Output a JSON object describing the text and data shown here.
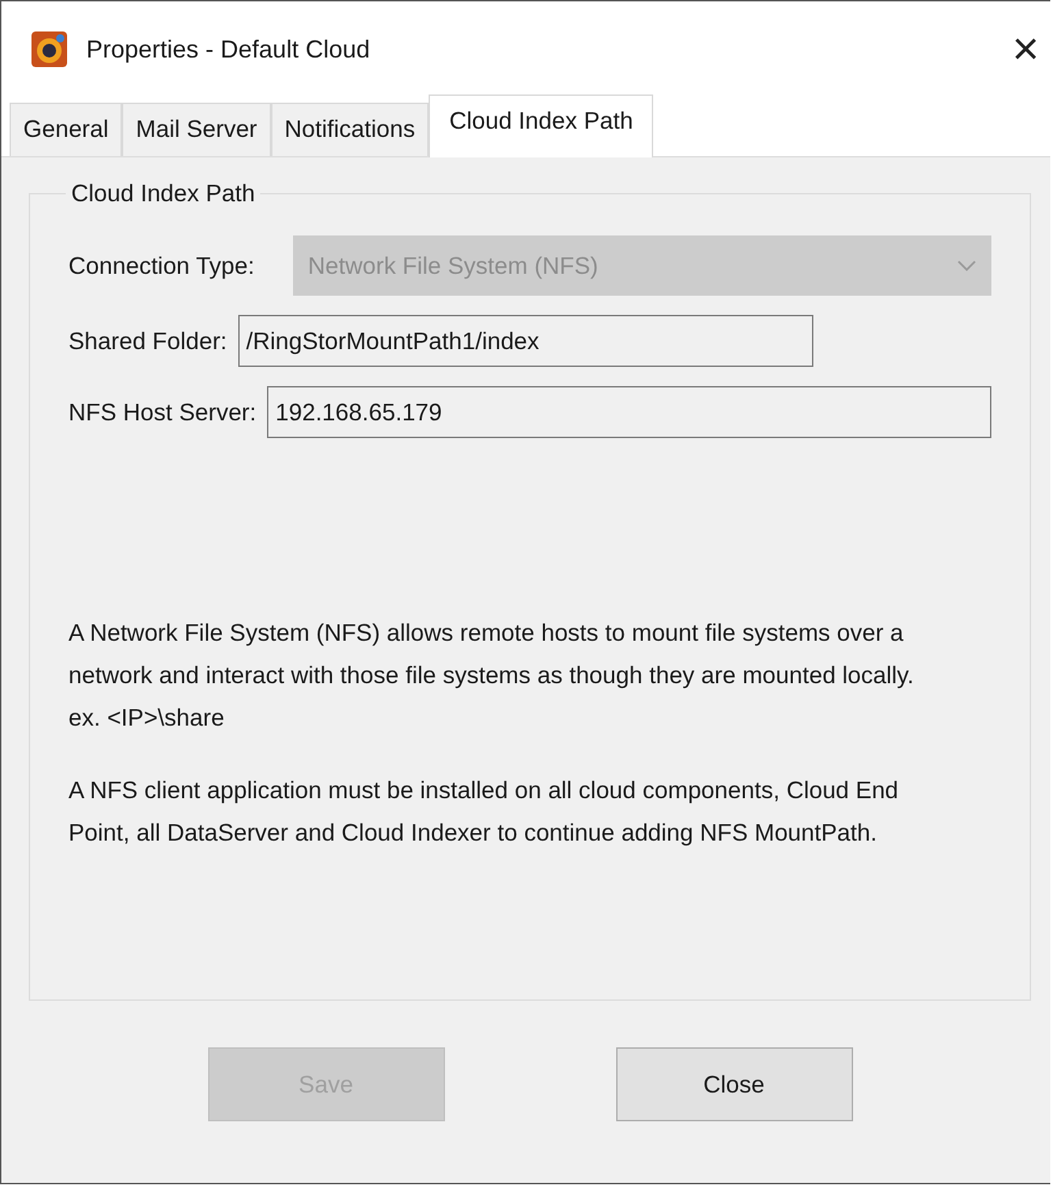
{
  "window": {
    "title": "Properties - Default Cloud",
    "close": "×"
  },
  "tabs": [
    {
      "label": "General",
      "selected": false
    },
    {
      "label": "Mail Server",
      "selected": false
    },
    {
      "label": "Notifications",
      "selected": false
    },
    {
      "label": "Cloud Index Path",
      "selected": true
    }
  ],
  "group": {
    "title": "Cloud Index Path",
    "fields": [
      {
        "kind": "dropdown",
        "label": "Connection Type:",
        "value": "Network File System (NFS)",
        "disabled": true
      },
      {
        "kind": "text",
        "label": "Shared Folder:",
        "value": "/RingStorMountPath1/index",
        "disabled": false
      },
      {
        "kind": "text",
        "label": "NFS Host Server:",
        "value": "192.168.65.179",
        "disabled": false
      }
    ],
    "notes": [
      "A Network File System (NFS) allows remote hosts to mount file systems over a network and interact with those file systems as though they are mounted locally. ex. <IP>\\share",
      "A NFS client application must be installed on all cloud components, Cloud End Point, all DataServer and Cloud Indexer to continue adding NFS MountPath."
    ]
  },
  "buttons": [
    {
      "label": "Save",
      "disabled": true
    },
    {
      "label": "Close",
      "disabled": false
    }
  ]
}
